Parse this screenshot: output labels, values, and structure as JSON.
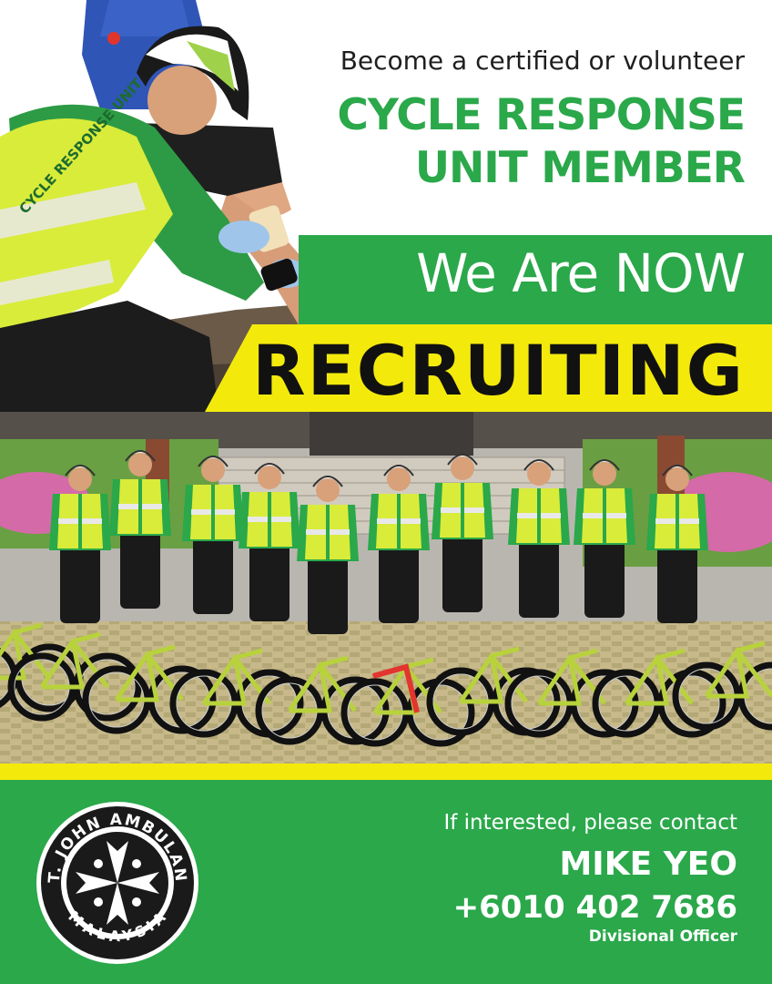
{
  "headline": {
    "intro": "Become a certified or volunteer",
    "main_line1": "CYCLE RESPONSE",
    "main_line2": "UNIT MEMBER",
    "now": "We Are NOW",
    "recruiting": "RECRUITING"
  },
  "contact": {
    "intro": "If interested, please contact",
    "name": "MIKE YEO",
    "phone": "+6010 402 7686",
    "role": "Divisional Officer"
  },
  "logo": {
    "text_top": "ST. JOHN AMBULANS",
    "text_bottom": "MALAYSIA"
  },
  "vest_text": "CYCLE RESPONSE UNIT",
  "colors": {
    "brand_green": "#2aa84a",
    "accent_yellow": "#f3ea0c",
    "vest_yellow": "#d9ec3a",
    "text_dark": "#1f1f1f"
  }
}
